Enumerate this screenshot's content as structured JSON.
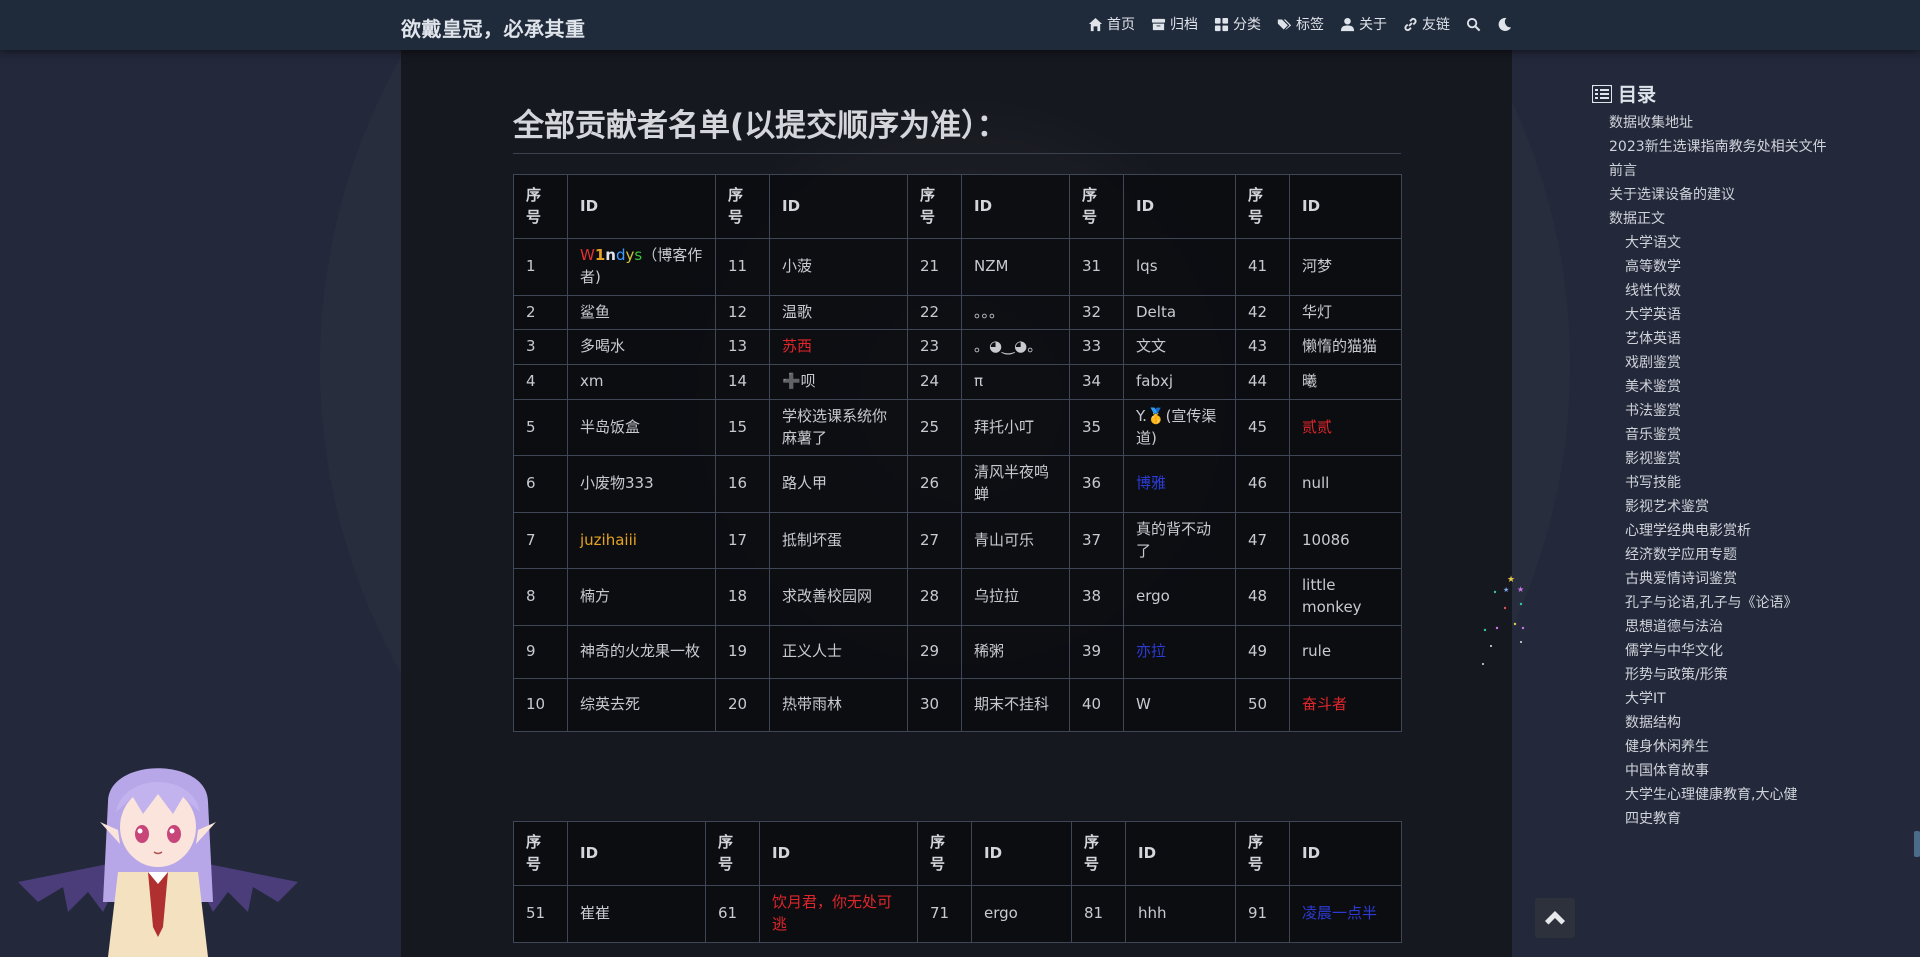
{
  "site": {
    "title": "欲戴皇冠，必承其重"
  },
  "nav": [
    {
      "label": "首页",
      "icon": "home-icon"
    },
    {
      "label": "归档",
      "icon": "archive-icon"
    },
    {
      "label": "分类",
      "icon": "category-icon"
    },
    {
      "label": "标签",
      "icon": "tag-icon"
    },
    {
      "label": "关于",
      "icon": "user-icon"
    },
    {
      "label": "友链",
      "icon": "link-icon"
    }
  ],
  "article": {
    "heading": "全部贡献者名单(以提交顺序为准）："
  },
  "table_headers": {
    "no": "序号",
    "id": "ID"
  },
  "table1_rows": [
    [
      {
        "n": "1",
        "id": "W1ndys（博客作者)",
        "style": "rainbow"
      },
      {
        "n": "11",
        "id": "小菠"
      },
      {
        "n": "21",
        "id": "NZM"
      },
      {
        "n": "31",
        "id": "lqs"
      },
      {
        "n": "41",
        "id": "河梦"
      }
    ],
    [
      {
        "n": "2",
        "id": "鲨鱼"
      },
      {
        "n": "12",
        "id": "温歌"
      },
      {
        "n": "22",
        "id": "。。。"
      },
      {
        "n": "32",
        "id": "Delta"
      },
      {
        "n": "42",
        "id": "华灯"
      }
    ],
    [
      {
        "n": "3",
        "id": "多喝水"
      },
      {
        "n": "13",
        "id": "苏西",
        "style": "red"
      },
      {
        "n": "23",
        "id": "。◕‿◕。"
      },
      {
        "n": "33",
        "id": "文文"
      },
      {
        "n": "43",
        "id": "懒惰的猫猫"
      }
    ],
    [
      {
        "n": "4",
        "id": "xm"
      },
      {
        "n": "14",
        "id": "➕呗"
      },
      {
        "n": "24",
        "id": "π"
      },
      {
        "n": "34",
        "id": "fabxj"
      },
      {
        "n": "44",
        "id": "曦"
      }
    ],
    [
      {
        "n": "5",
        "id": "半岛饭盒"
      },
      {
        "n": "15",
        "id": "学校选课系统你麻薯了"
      },
      {
        "n": "25",
        "id": "拜托小叮"
      },
      {
        "n": "35",
        "id": "Y.🥇(宣传渠道)"
      },
      {
        "n": "45",
        "id": "贰贰",
        "style": "red"
      }
    ],
    [
      {
        "n": "6",
        "id": "小废物333"
      },
      {
        "n": "16",
        "id": "路人甲"
      },
      {
        "n": "26",
        "id": "清风半夜鸣蝉"
      },
      {
        "n": "36",
        "id": "博雅",
        "style": "blue"
      },
      {
        "n": "46",
        "id": "null"
      }
    ],
    [
      {
        "n": "7",
        "id": "juzihaiii",
        "style": "orange"
      },
      {
        "n": "17",
        "id": "抵制坏蛋"
      },
      {
        "n": "27",
        "id": "青山可乐"
      },
      {
        "n": "37",
        "id": "真的背不动了"
      },
      {
        "n": "47",
        "id": "10086"
      }
    ],
    [
      {
        "n": "8",
        "id": "楠方"
      },
      {
        "n": "18",
        "id": "求改善校园网"
      },
      {
        "n": "28",
        "id": "乌拉拉"
      },
      {
        "n": "38",
        "id": "ergo"
      },
      {
        "n": "48",
        "id": "little monkey"
      }
    ],
    [
      {
        "n": "9",
        "id": "神奇的火龙果一枚"
      },
      {
        "n": "19",
        "id": "正义人士"
      },
      {
        "n": "29",
        "id": "稀粥"
      },
      {
        "n": "39",
        "id": "亦拉",
        "style": "blue"
      },
      {
        "n": "49",
        "id": "rule"
      }
    ],
    [
      {
        "n": "10",
        "id": "综英去死"
      },
      {
        "n": "20",
        "id": "热带雨林"
      },
      {
        "n": "30",
        "id": "期末不挂科"
      },
      {
        "n": "40",
        "id": "W"
      },
      {
        "n": "50",
        "id": "奋斗者",
        "style": "red"
      }
    ]
  ],
  "table2_rows": [
    [
      {
        "n": "51",
        "id": "崔崔"
      },
      {
        "n": "61",
        "id": "饮月君，你无处可逃",
        "style": "red"
      },
      {
        "n": "71",
        "id": "ergo"
      },
      {
        "n": "81",
        "id": "hhh"
      },
      {
        "n": "91",
        "id": "凌晨一点半",
        "style": "blue"
      }
    ]
  ],
  "toc": {
    "title": "目录",
    "items": [
      {
        "label": "数据收集地址",
        "level": 1
      },
      {
        "label": "2023新生选课指南教务处相关文件",
        "level": 1
      },
      {
        "label": "前言",
        "level": 1
      },
      {
        "label": "关于选课设备的建议",
        "level": 1
      },
      {
        "label": "数据正文",
        "level": 1
      },
      {
        "label": "大学语文",
        "level": 2
      },
      {
        "label": "高等数学",
        "level": 2
      },
      {
        "label": "线性代数",
        "level": 2
      },
      {
        "label": "大学英语",
        "level": 2
      },
      {
        "label": "艺体英语",
        "level": 2
      },
      {
        "label": "戏剧鉴赏",
        "level": 2
      },
      {
        "label": "美术鉴赏",
        "level": 2
      },
      {
        "label": "书法鉴赏",
        "level": 2
      },
      {
        "label": "音乐鉴赏",
        "level": 2
      },
      {
        "label": "影视鉴赏",
        "level": 2
      },
      {
        "label": "书写技能",
        "level": 2
      },
      {
        "label": "影视艺术鉴赏",
        "level": 2
      },
      {
        "label": "心理学经典电影赏析",
        "level": 2
      },
      {
        "label": "经济数学应用专题",
        "level": 2
      },
      {
        "label": "古典爱情诗词鉴赏",
        "level": 2
      },
      {
        "label": "孔子与论语,孔子与《论语》",
        "level": 2
      },
      {
        "label": "思想道德与法治",
        "level": 2
      },
      {
        "label": "儒学与中华文化",
        "level": 2
      },
      {
        "label": "形势与政策/形策",
        "level": 2
      },
      {
        "label": "大学IT",
        "level": 2
      },
      {
        "label": "数据结构",
        "level": 2
      },
      {
        "label": "健身休闲养生",
        "level": 2
      },
      {
        "label": "中国体育故事",
        "level": 2
      },
      {
        "label": "大学生心理健康教育,大心健",
        "level": 2
      },
      {
        "label": "四史教育",
        "level": 2
      }
    ]
  },
  "colors": {
    "navbar_bg": "#1f2a3b",
    "page_bg": "#23283a",
    "article_bg": "#16181f",
    "red_id": "#e0262a",
    "orange_id": "#e6a322",
    "blue_id": "#2c3bd6"
  }
}
